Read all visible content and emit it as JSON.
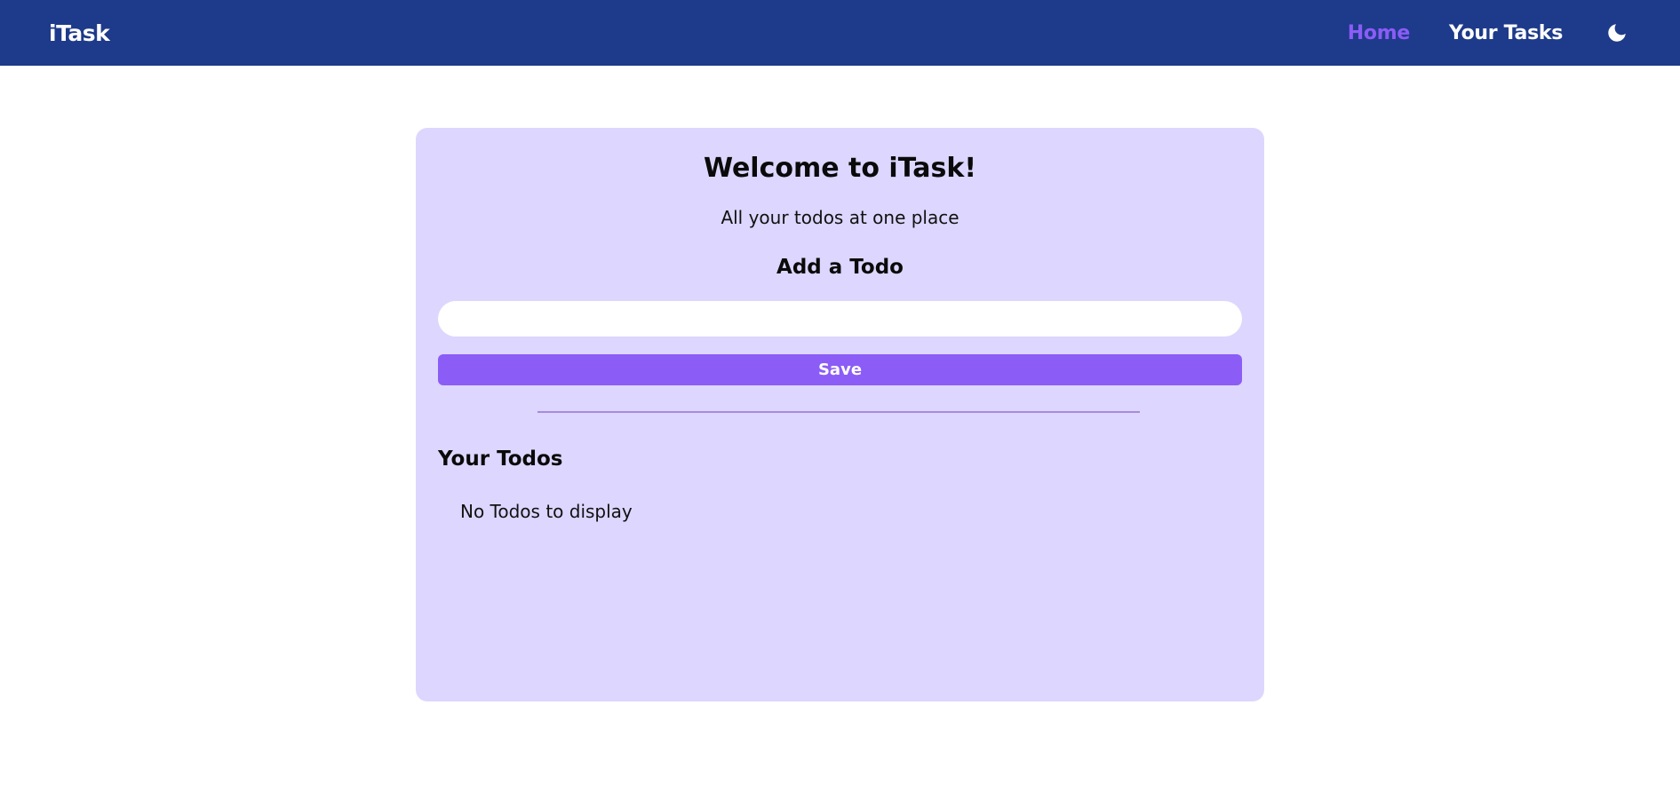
{
  "navbar": {
    "brand": "iTask",
    "links": [
      {
        "label": "Home",
        "active": true
      },
      {
        "label": "Your Tasks",
        "active": false
      }
    ],
    "theme_toggle_icon": "moon-icon"
  },
  "main": {
    "title": "Welcome to iTask!",
    "subtitle": "All your todos at one place",
    "add_heading": "Add a Todo",
    "input": {
      "value": "",
      "placeholder": ""
    },
    "save_label": "Save",
    "todos_heading": "Your Todos",
    "empty_message": "No Todos to display"
  },
  "colors": {
    "navbar_bg": "#1e3a8a",
    "accent": "#8b5cf6",
    "card_bg": "#ddd6fe"
  }
}
